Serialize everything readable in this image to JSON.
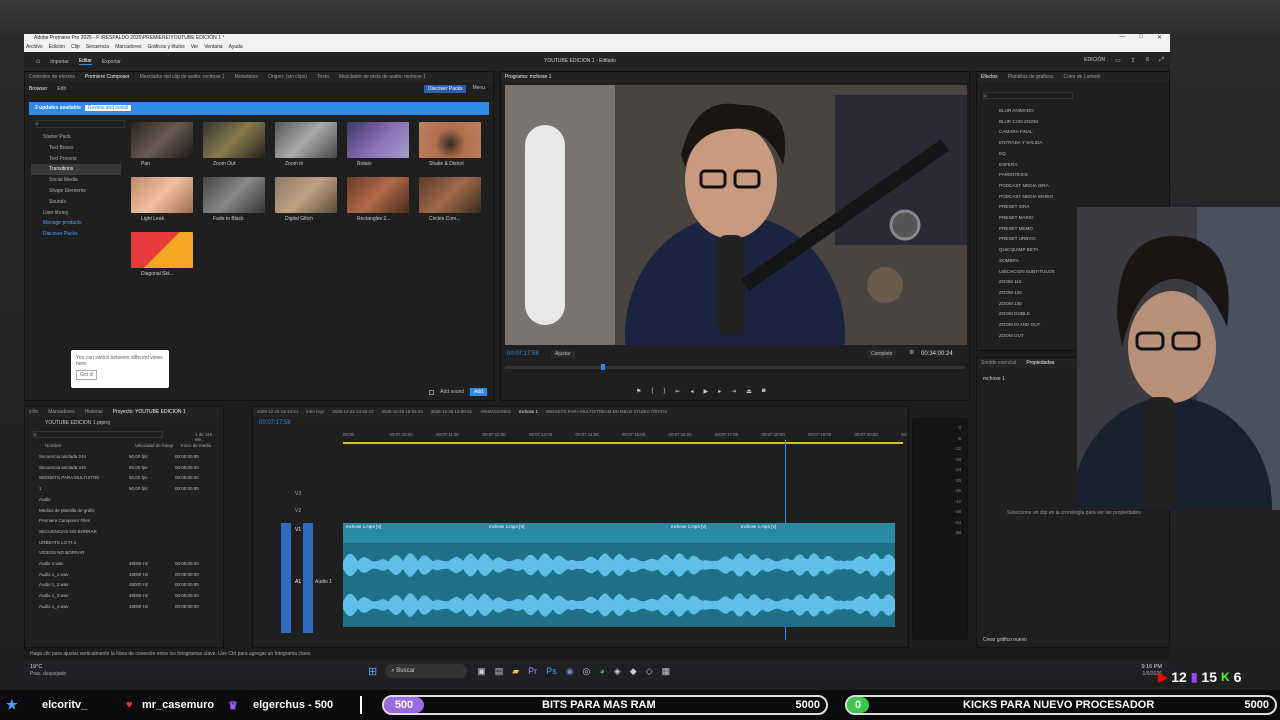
{
  "app": {
    "title": "Adobe Premiere Pro 2025 - F:\\RESPALDO 2025\\PREMIERE\\YOUTUBE EDICION 1 *",
    "menu": [
      "Archivo",
      "Edición",
      "Clip",
      "Secuencia",
      "Marcadores",
      "Gráficos y títulos",
      "Ver",
      "Ventana",
      "Ayuda"
    ],
    "tabs": [
      "Importar",
      "Editar",
      "Exportar"
    ],
    "center_title": "YOUTUBE EDICION 1 - Editado",
    "workspace": "EDICIÓN"
  },
  "effects_browser": {
    "tabs": [
      "Controles de efectos",
      "Premiere Composer",
      "Mezclador del clip de audio: mchose 1",
      "Metadatos",
      "Origen: (sin clips)",
      "Texto",
      "Mezclador de pista de audio: mchose 1"
    ],
    "subtabs": [
      "Browser",
      "Edit"
    ],
    "discover": "Discover Packs",
    "menu": "Menu",
    "updates_text": "2 updates available",
    "updates_btn": "Review and install",
    "tree": [
      "Starter Pack",
      "Text Boxes",
      "Text Presets",
      "Transitions",
      "Social Media",
      "Shape Elements",
      "Sounds",
      "User library",
      "Manage products",
      "Discover Packs"
    ],
    "thumbs": [
      "Pan",
      "Zoom Out",
      "Zoom In",
      "Rotate",
      "Shake & Distort",
      "Light Leak",
      "Fade to Black",
      "Digital Glitch",
      "Rectangles 2...",
      "Circles Com...",
      "Diagonal Skt..."
    ],
    "tooltip_text": "You can switch between different views here.",
    "tooltip_btn": "Got it!",
    "add_sound": "Add sound",
    "add_btn": "Add"
  },
  "monitor": {
    "title": "Programa: mchose 1",
    "timecode": "00:07:17:58",
    "fit": "Ajustar",
    "quality": "Completo",
    "duration": "00:34:00:24"
  },
  "effects_panel": {
    "tabs": [
      "Efectos",
      "Plantillas de gráficos",
      "Color de Lumetri"
    ],
    "items": [
      "BLUR ANIMADO",
      "BLUR CON ZOOM",
      "CAMARA FINAL",
      "ENTRADA Y SALIDA",
      "EQ",
      "ESFERA",
      "PARENTESIS",
      "PODCAST MEDIA ISRA",
      "PODCAST MEDIA MARIO",
      "PRESET ISRA",
      "PRESET MARIO",
      "PRESET MEMO",
      "PRESET URBVIC",
      "QUICQUIMP BETA",
      "SOMBRA",
      "UBICACION SUBTITULOS",
      "ZOOM 110",
      "ZOOM 120",
      "ZOOM 130",
      "ZOOM DOBLE",
      "ZOOM IN AND OUT",
      "ZOOM OUT"
    ]
  },
  "props": {
    "tabs": [
      "Sonido esencial",
      "Propiedades"
    ],
    "seq": "mchose 1",
    "hint": "Seleccione un clip en la cronología para ver las propiedades",
    "create": "Crear gráfico nuevo"
  },
  "project": {
    "tabs": [
      "ción",
      "Marcadores",
      "Historial",
      "Proyecto: YOUTUBE EDICION 1"
    ],
    "file": "YOUTUBE EDICION 1.prproj",
    "count": "1 de 116 ele...",
    "cols": [
      "Nombre",
      "Velocidad de fotogr",
      "Inicio de medio"
    ],
    "rows": [
      [
        "Secuencia anidada 244",
        "60,00 fps",
        "00:00:00:00"
      ],
      [
        "Secuencia anidada 245",
        "60,00 fps",
        "00:00:00:00"
      ],
      [
        "WIDGETS PARA MULTISTRE",
        "60,00 fps",
        "00:00:00:00"
      ],
      [
        "1",
        "60,00 fps",
        "00:00:00:00"
      ],
      [
        "Audio",
        "",
        ""
      ],
      [
        "Medios de plantilla de gráfic",
        "",
        ""
      ],
      [
        "Premiere Composer Files",
        "",
        ""
      ],
      [
        "SECUENCIAS NO BORRAR",
        "",
        ""
      ],
      [
        "URBEATS LO FI 2",
        "",
        ""
      ],
      [
        "VIDEOS NO BORRAR",
        "",
        ""
      ],
      [
        "Audio 1.wav",
        "48000 Hz",
        "00:00:00:00"
      ],
      [
        "Audio 1_1.wav",
        "48000 Hz",
        "00:00:00:00"
      ],
      [
        "Audio 1_2.wav",
        "48000 Hz",
        "00:00:00:00"
      ],
      [
        "Audio 1_3.wav",
        "48000 Hz",
        "00:00:00:00"
      ],
      [
        "Audio 1_4.wav",
        "48000 Hz",
        "00:00:00:00"
      ]
    ]
  },
  "timeline": {
    "seq_tabs": [
      "2025-12-15 13-14-21",
      "intro logo",
      "2025-12-22 14-53-12",
      "2025-12-28 18-52-24",
      "2025-12-26 13-00-51",
      "ANIMACIONES",
      "mchose 1",
      "WIDGETS PARA MULTISTREAM EN MELD STUDIO GRATIS"
    ],
    "timecode": "00:07:17:58",
    "ruler": [
      "00:00",
      "00:07:10:00",
      "00:07:11:00",
      "00:07:12:00",
      "00:07:13:00",
      "00:07:14:00",
      "00:07:15:00",
      "00:07:16:00",
      "00:07:17:00",
      "00:07:18:00",
      "00:07:19:00",
      "00:07:20:00",
      "00:"
    ],
    "tracks": [
      "V3",
      "V2",
      "V1",
      "A1"
    ],
    "audio_label": "Audio 1",
    "clips": [
      "mchose 1.mp4 [V]",
      "mchose 1.mp4 [V]",
      "mchose 1.mp4 [V]",
      "mchose 1.mp4 [V]"
    ]
  },
  "meter_labels": [
    "0",
    "-6",
    "-12",
    "-18",
    "-24",
    "-30",
    "-36",
    "-42",
    "-48",
    "-54",
    "dB"
  ],
  "status": "Haga clic para ajustar verticalmente la línea de conexión entre los fotogramas clave. Use Ctrl para agregar un fotograma clave.",
  "taskbar": {
    "weather_temp": "19°C",
    "weather_desc": "Prac. despejado",
    "search": "Buscar",
    "time": "9:16 PM",
    "date": "1/6/2026"
  },
  "stream": {
    "names": [
      "elcoritv_",
      "mr_casemuro",
      "elgerchus - 500"
    ],
    "goal1_count": "500",
    "goal1_label": "BITS PARA MAS RAM",
    "goal1_target": "5000",
    "goal2_count": "0",
    "goal2_label": "KICKS PARA NUEVO PROCESADOR",
    "goal2_target": "5000",
    "yt_viewers": "12",
    "twitch_viewers": "15",
    "kick_viewers": "6"
  }
}
